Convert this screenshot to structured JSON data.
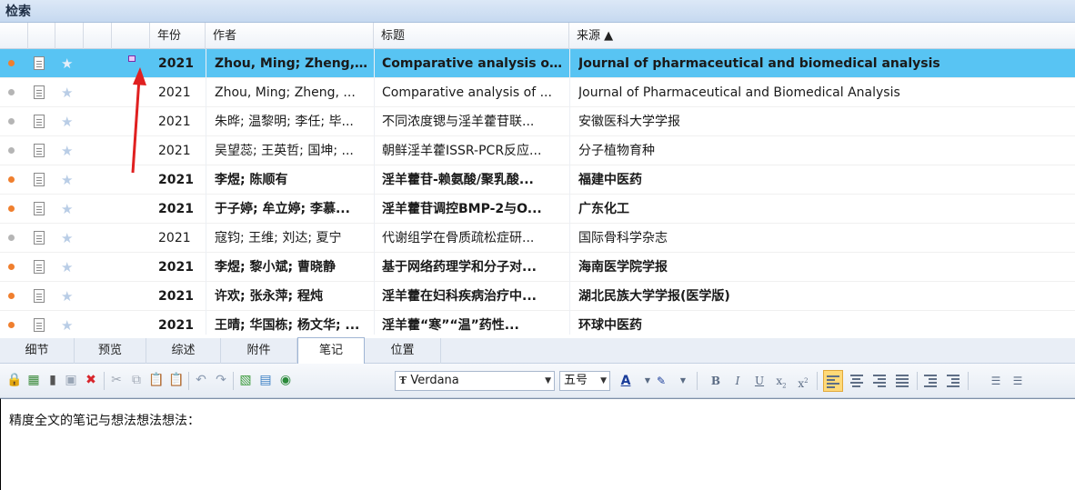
{
  "panel": {
    "title": "检索"
  },
  "columns": {
    "year": "年份",
    "author": "作者",
    "title": "标题",
    "source": "来源 ▲"
  },
  "rows": [
    {
      "year": "2021",
      "author": "Zhou, Ming; Zheng, ...",
      "title": "Comparative analysis of ...",
      "source": "Journal of pharmaceutical and biomedical analysis",
      "unread": true,
      "selected": true,
      "tag": true
    },
    {
      "year": "2021",
      "author": "Zhou, Ming; Zheng, ...",
      "title": "Comparative analysis of ...",
      "source": "Journal of Pharmaceutical and Biomedical Analysis",
      "unread": false,
      "selected": false,
      "tag": false
    },
    {
      "year": "2021",
      "author": "朱晔; 温黎明; 李任; 毕...",
      "title": "不同浓度锶与淫羊藿苷联...",
      "source": "安徽医科大学学报",
      "unread": false,
      "selected": false,
      "tag": false
    },
    {
      "year": "2021",
      "author": "吴望蕊; 王英哲; 国坤; ...",
      "title": "朝鲜淫羊藿ISSR-PCR反应...",
      "source": "分子植物育种",
      "unread": false,
      "selected": false,
      "tag": false
    },
    {
      "year": "2021",
      "author": "李煜; 陈顺有",
      "title": "淫羊藿苷-赖氨酸/聚乳酸...",
      "source": "福建中医药",
      "unread": true,
      "selected": false,
      "tag": false
    },
    {
      "year": "2021",
      "author": "于子婷; 牟立婷; 李慕...",
      "title": "淫羊藿苷调控BMP-2与O...",
      "source": "广东化工",
      "unread": true,
      "selected": false,
      "tag": false
    },
    {
      "year": "2021",
      "author": "寇钧; 王维; 刘达; 夏宁",
      "title": "代谢组学在骨质疏松症研...",
      "source": "国际骨科学杂志",
      "unread": false,
      "selected": false,
      "tag": false
    },
    {
      "year": "2021",
      "author": "李煜; 黎小斌; 曹晓静",
      "title": "基于网络药理学和分子对...",
      "source": "海南医学院学报",
      "unread": true,
      "selected": false,
      "tag": false
    },
    {
      "year": "2021",
      "author": "许欢; 张永萍; 程炖",
      "title": "淫羊藿在妇科疾病治疗中...",
      "source": "湖北民族大学学报(医学版)",
      "unread": true,
      "selected": false,
      "tag": false
    },
    {
      "year": "2021",
      "author": "王晴; 华国栋; 杨文华; ...",
      "title": "淫羊藿“寒”“温”药性...",
      "source": "环球中医药",
      "unread": true,
      "selected": false,
      "tag": false
    }
  ],
  "tabs": [
    "细节",
    "预览",
    "综述",
    "附件",
    "笔记",
    "位置"
  ],
  "active_tab": "笔记",
  "toolbar": {
    "font": "Verdana",
    "font_size": "五号"
  },
  "note": {
    "text": "精度全文的笔记与想法想法想法："
  },
  "colors": {
    "selected_row": "#58c4f3",
    "unread_dot": "#f07f2e",
    "read_dot": "#b5b5b5",
    "arrow": "#e02020"
  }
}
